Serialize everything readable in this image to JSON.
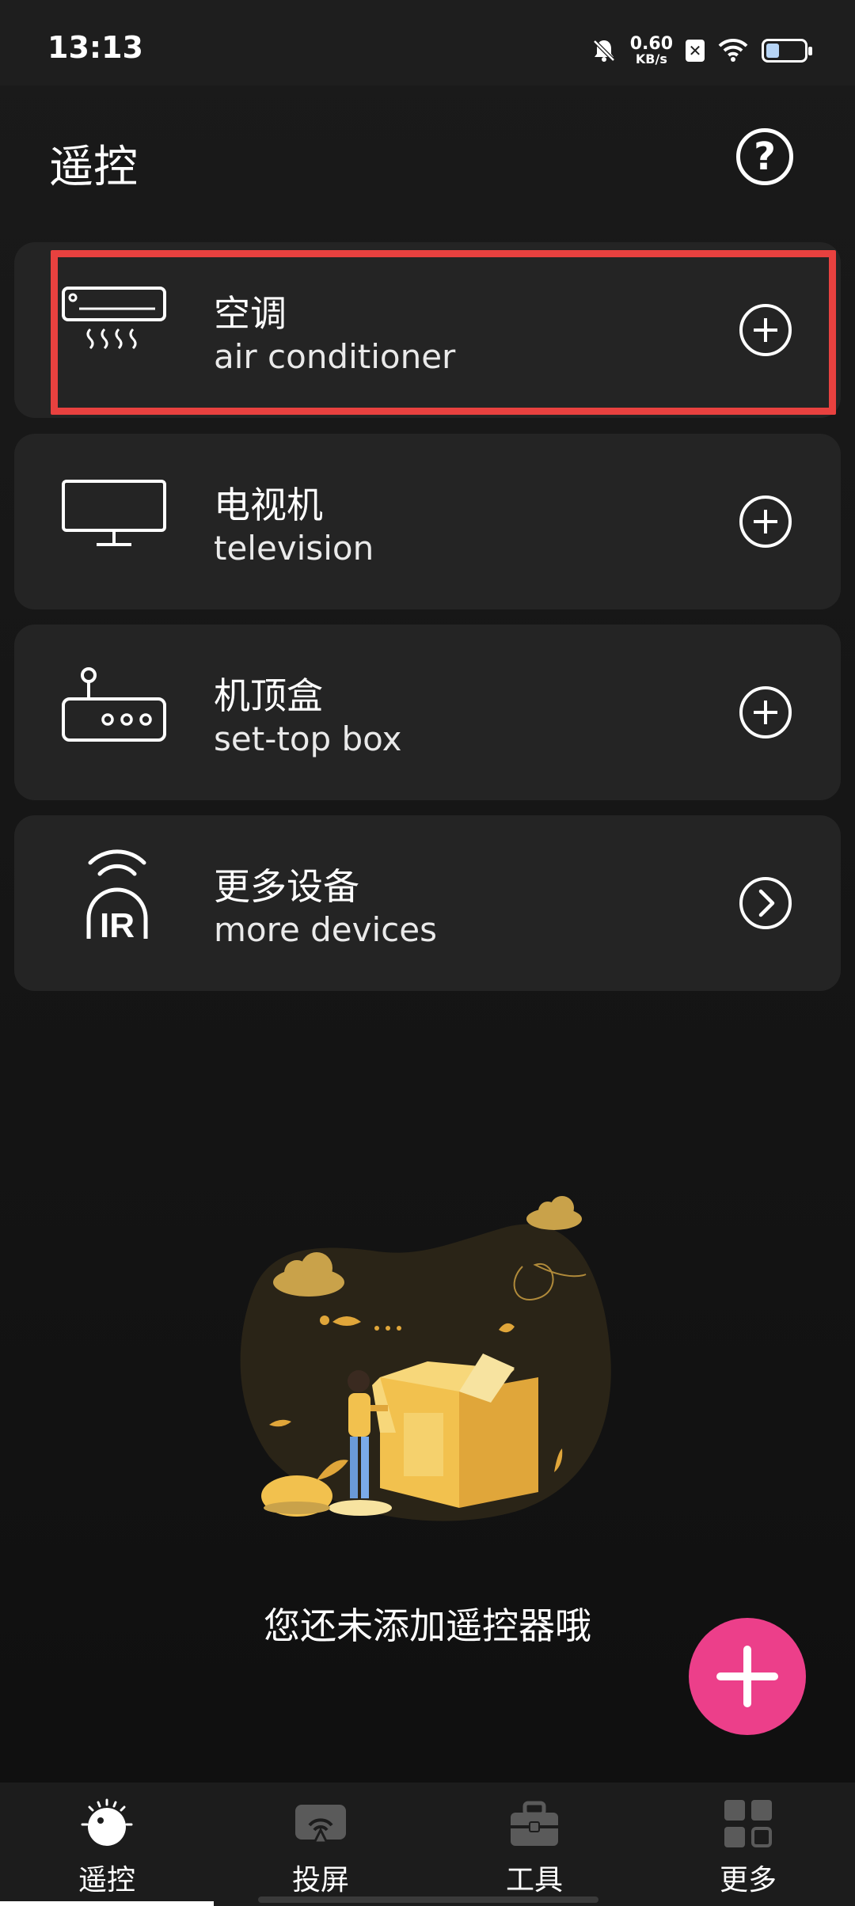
{
  "status_bar": {
    "time": "13:13",
    "net_speed_value": "0.60",
    "net_speed_unit": "KB/s",
    "sim_label": "✕",
    "battery_level": 0.35
  },
  "header": {
    "title": "遥控",
    "help_label": "?"
  },
  "devices": [
    {
      "title": "空调",
      "subtitle": "air conditioner",
      "icon": "air-conditioner-icon",
      "action": "add-icon"
    },
    {
      "title": "电视机",
      "subtitle": "television",
      "icon": "television-icon",
      "action": "add-icon"
    },
    {
      "title": "机顶盒",
      "subtitle": "set-top box",
      "icon": "set-top-box-icon",
      "action": "add-icon"
    },
    {
      "title": "更多设备",
      "subtitle": "more devices",
      "icon": "ir-remote-icon",
      "action": "chevron-right-icon"
    }
  ],
  "ir_label": "IR",
  "empty_state": {
    "message": "您还未添加遥控器哦"
  },
  "fab": {
    "icon": "plus-icon"
  },
  "bottom_nav": {
    "items": [
      {
        "label": "遥控",
        "icon": "remote-dial-icon",
        "active": true
      },
      {
        "label": "投屏",
        "icon": "screen-cast-icon",
        "active": false
      },
      {
        "label": "工具",
        "icon": "toolbox-icon",
        "active": false
      },
      {
        "label": "更多",
        "icon": "grid-more-icon",
        "active": false
      }
    ]
  },
  "colors": {
    "background": "#121212",
    "card": "#242424",
    "highlight": "#e8413f",
    "fab": "#ec3f8a",
    "illustration_gold": "#f2c14e"
  }
}
